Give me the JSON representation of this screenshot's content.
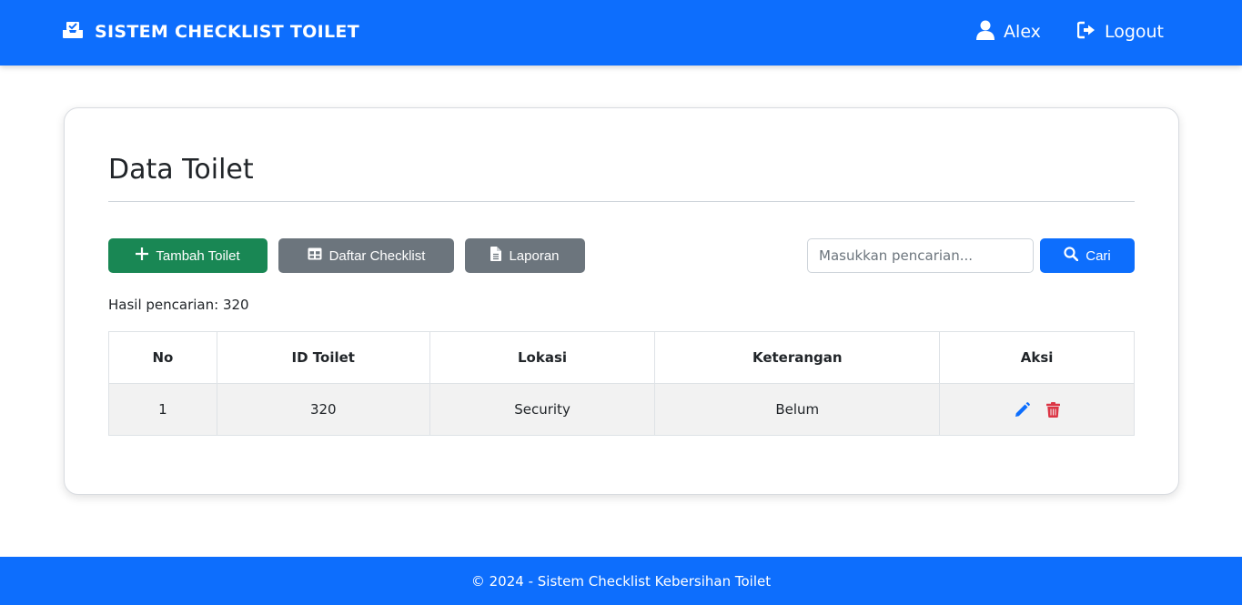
{
  "navbar": {
    "brand_icon": "inbox-check-icon",
    "brand_title": "SISTEM CHECKLIST TOILET",
    "user_icon": "user-icon",
    "user_name": "Alex",
    "logout_icon": "logout-icon",
    "logout_label": "Logout"
  },
  "main": {
    "page_title": "Data Toilet",
    "buttons": {
      "add_label": "Tambah Toilet",
      "add_icon": "plus-icon",
      "list_label": "Daftar Checklist",
      "list_icon": "table-icon",
      "report_label": "Laporan",
      "report_icon": "file-icon"
    },
    "search": {
      "placeholder": "Masukkan pencarian...",
      "value": "",
      "button_label": "Cari",
      "button_icon": "search-icon"
    },
    "result_text": "Hasil pencarian: 320",
    "table": {
      "headers": [
        "No",
        "ID Toilet",
        "Lokasi",
        "Keterangan",
        "Aksi"
      ],
      "rows": [
        {
          "no": "1",
          "id_toilet": "320",
          "lokasi": "Security",
          "keterangan": "Belum",
          "actions": [
            "edit-icon",
            "trash-icon"
          ]
        }
      ]
    }
  },
  "footer": {
    "text": "© 2024 - Sistem Checklist Kebersihan Toilet"
  },
  "colors": {
    "primary": "#0d6efd",
    "success": "#198754",
    "secondary": "#6c757d",
    "danger": "#dc3545",
    "row_bg": "#f2f2f2"
  }
}
